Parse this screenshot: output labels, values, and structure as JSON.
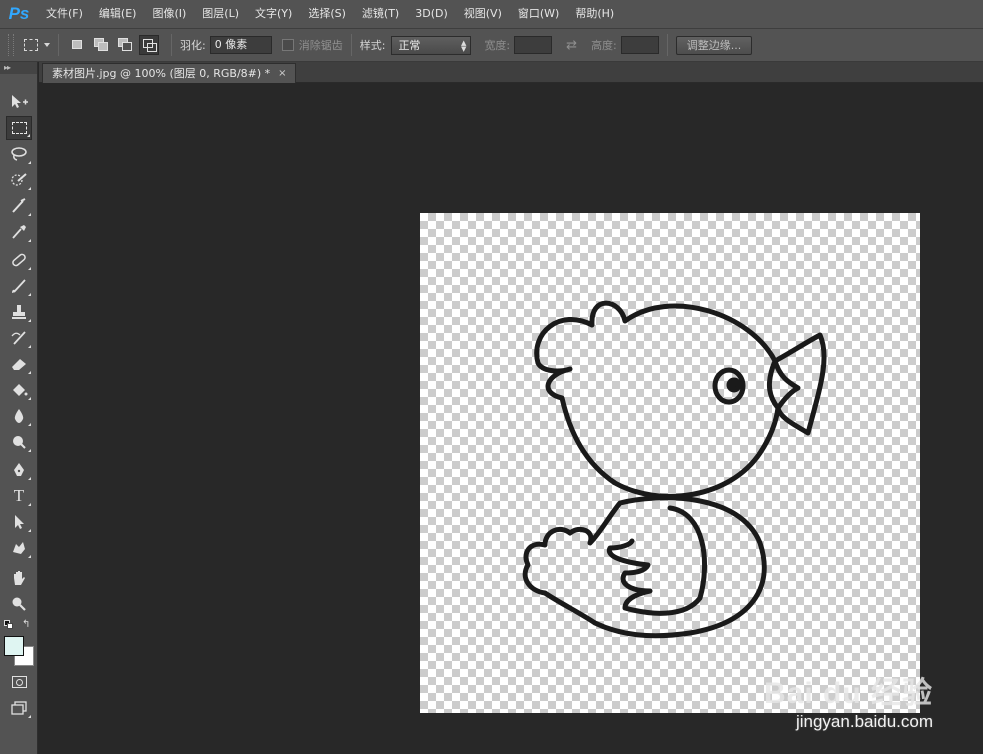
{
  "app": {
    "logo": "Ps"
  },
  "menu": [
    "文件(F)",
    "编辑(E)",
    "图像(I)",
    "图层(L)",
    "文字(Y)",
    "选择(S)",
    "滤镜(T)",
    "3D(D)",
    "视图(V)",
    "窗口(W)",
    "帮助(H)"
  ],
  "options": {
    "feather_label": "羽化:",
    "feather_value": "0 像素",
    "antialias_label": "消除锯齿",
    "style_label": "样式:",
    "style_value": "正常",
    "width_label": "宽度:",
    "swap_glyph": "⇄",
    "height_label": "高度:",
    "refine_edge_label": "调整边缘..."
  },
  "toolbox": {
    "collapse_glyph": "▸▸"
  },
  "document": {
    "tab_title": "素材图片.jpg @ 100% (图层 0, RGB/8#) *",
    "close_glyph": "×"
  },
  "colors": {
    "foreground": "#dff5f2",
    "background": "#ffffff"
  },
  "watermark": {
    "logo": "Bai du 经验",
    "url": "jingyan.baidu.com"
  }
}
